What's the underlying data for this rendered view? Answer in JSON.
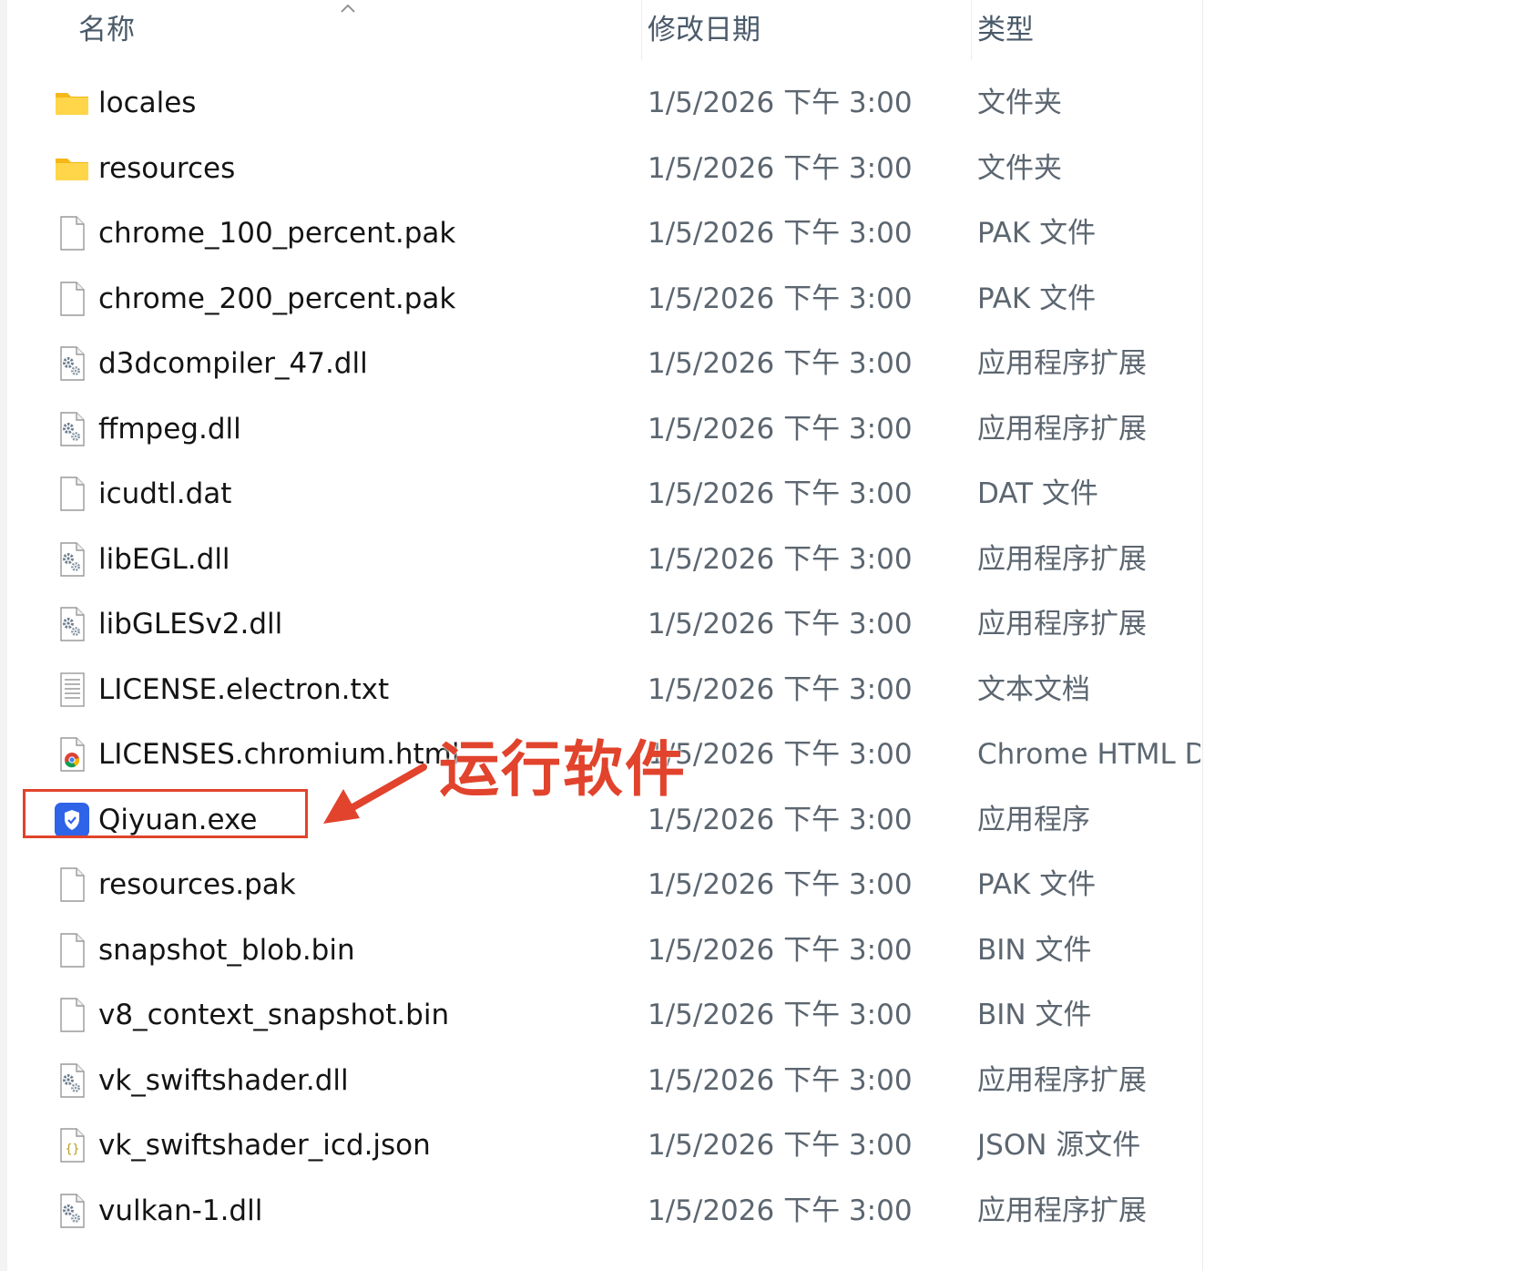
{
  "header": {
    "name_label": "名称",
    "date_label": "修改日期",
    "type_label": "类型",
    "sort_indicator": "chevron-up-icon"
  },
  "files": [
    {
      "name": "locales",
      "date": "1/5/2026 下午 3:00",
      "type": "文件夹",
      "icon": "folder-icon"
    },
    {
      "name": "resources",
      "date": "1/5/2026 下午 3:00",
      "type": "文件夹",
      "icon": "folder-icon"
    },
    {
      "name": "chrome_100_percent.pak",
      "date": "1/5/2026 下午 3:00",
      "type": "PAK 文件",
      "icon": "file-icon"
    },
    {
      "name": "chrome_200_percent.pak",
      "date": "1/5/2026 下午 3:00",
      "type": "PAK 文件",
      "icon": "file-icon"
    },
    {
      "name": "d3dcompiler_47.dll",
      "date": "1/5/2026 下午 3:00",
      "type": "应用程序扩展",
      "icon": "dll-gear-icon"
    },
    {
      "name": "ffmpeg.dll",
      "date": "1/5/2026 下午 3:00",
      "type": "应用程序扩展",
      "icon": "dll-gear-icon"
    },
    {
      "name": "icudtl.dat",
      "date": "1/5/2026 下午 3:00",
      "type": "DAT 文件",
      "icon": "file-icon"
    },
    {
      "name": "libEGL.dll",
      "date": "1/5/2026 下午 3:00",
      "type": "应用程序扩展",
      "icon": "dll-gear-icon"
    },
    {
      "name": "libGLESv2.dll",
      "date": "1/5/2026 下午 3:00",
      "type": "应用程序扩展",
      "icon": "dll-gear-icon"
    },
    {
      "name": "LICENSE.electron.txt",
      "date": "1/5/2026 下午 3:00",
      "type": "文本文档",
      "icon": "text-file-icon"
    },
    {
      "name": "LICENSES.chromium.html",
      "date": "1/5/2026 下午 3:00",
      "type": "Chrome HTML D",
      "icon": "chrome-html-icon"
    },
    {
      "name": "Qiyuan.exe",
      "date": "1/5/2026 下午 3:00",
      "type": "应用程序",
      "icon": "shield-app-icon"
    },
    {
      "name": "resources.pak",
      "date": "1/5/2026 下午 3:00",
      "type": "PAK 文件",
      "icon": "file-icon"
    },
    {
      "name": "snapshot_blob.bin",
      "date": "1/5/2026 下午 3:00",
      "type": "BIN 文件",
      "icon": "file-icon"
    },
    {
      "name": "v8_context_snapshot.bin",
      "date": "1/5/2026 下午 3:00",
      "type": "BIN 文件",
      "icon": "file-icon"
    },
    {
      "name": "vk_swiftshader.dll",
      "date": "1/5/2026 下午 3:00",
      "type": "应用程序扩展",
      "icon": "dll-gear-icon"
    },
    {
      "name": "vk_swiftshader_icd.json",
      "date": "1/5/2026 下午 3:00",
      "type": "JSON 源文件",
      "icon": "json-file-icon"
    },
    {
      "name": "vulkan-1.dll",
      "date": "1/5/2026 下午 3:00",
      "type": "应用程序扩展",
      "icon": "dll-gear-icon"
    }
  ],
  "annotation": {
    "text": "运行软件",
    "color": "#e1432c",
    "target_file": "Qiyuan.exe"
  },
  "colors": {
    "folder": "#f8c52a",
    "app_shield": "#2f63e8",
    "annotation": "#e1432c"
  }
}
